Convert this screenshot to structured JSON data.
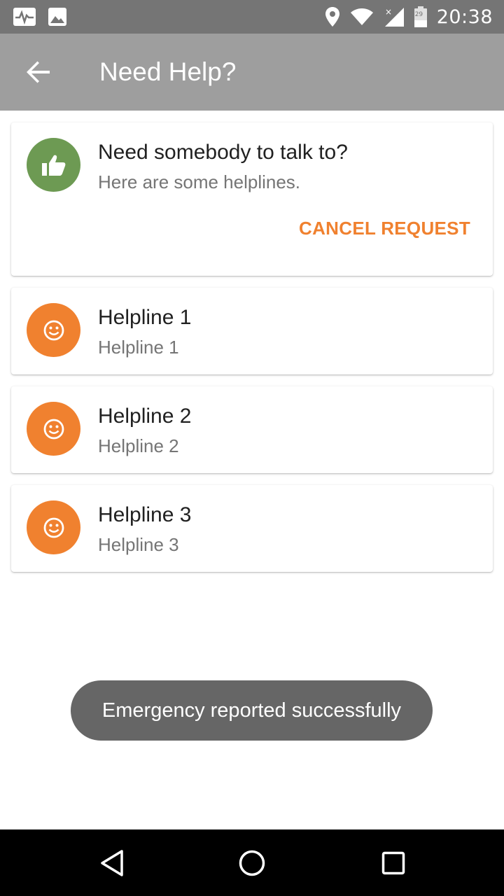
{
  "status_bar": {
    "time": "20:38",
    "left_icons": [
      "activity-icon",
      "image-icon"
    ],
    "right_icons": [
      "location-icon",
      "wifi-icon",
      "cell-signal-icon",
      "battery-icon"
    ],
    "battery_level": "29"
  },
  "app_bar": {
    "title": "Need Help?",
    "back_icon": "arrow-left-icon"
  },
  "header_card": {
    "icon": "thumbs-up-icon",
    "title": "Need somebody to talk to?",
    "subtitle": "Here are some helplines.",
    "cancel_label": "CANCEL REQUEST"
  },
  "helplines": [
    {
      "title": "Helpline 1",
      "subtitle": "Helpline 1",
      "icon": "smiley-icon"
    },
    {
      "title": "Helpline 2",
      "subtitle": "Helpline 2",
      "icon": "smiley-icon"
    },
    {
      "title": "Helpline 3",
      "subtitle": "Helpline 3",
      "icon": "smiley-icon"
    }
  ],
  "toast": {
    "message": "Emergency reported successfully"
  },
  "nav_bar": {
    "icons": [
      "back-triangle-icon",
      "home-circle-icon",
      "recents-square-icon"
    ]
  },
  "colors": {
    "status_bar": "#757575",
    "app_bar": "#9e9e9e",
    "accent": "#f0812f",
    "green": "#6d9a53",
    "toast": "#666666"
  }
}
